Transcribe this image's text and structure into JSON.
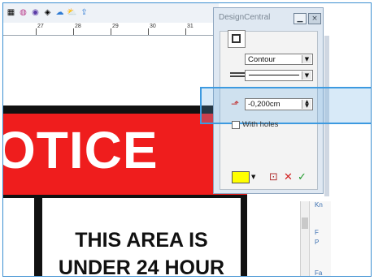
{
  "ruler": {
    "numbers": [
      "27",
      "28",
      "29",
      "30",
      "31"
    ]
  },
  "sign": {
    "header_fragment": "OTICE",
    "lines": [
      "THIS AREA IS",
      "UNDER 24 HOUR"
    ],
    "colors": {
      "red": "#ef1d1d",
      "black": "#111111",
      "white": "#ffffff"
    }
  },
  "panel": {
    "title": "DesignCentral",
    "contour_select": {
      "value": "Contour"
    },
    "line_select": {
      "value": ""
    },
    "offset_field": {
      "value": "-0,200cm"
    },
    "with_holes_label": "With holes",
    "fill_color": "#ffff00"
  },
  "side_strip": {
    "labels": [
      "Kn",
      "F",
      "P",
      "Fa"
    ]
  },
  "icons": {
    "toolbar": [
      "color-palette-icon",
      "color-wheel-icon",
      "crop-icon",
      "layers-icon",
      "cloud-icon",
      "cloud-up-icon",
      "cloud-share-icon"
    ],
    "panel": [
      "contour-tool-icon",
      "offset-icon",
      "apply-icon",
      "cancel-icon",
      "check-icon"
    ]
  }
}
